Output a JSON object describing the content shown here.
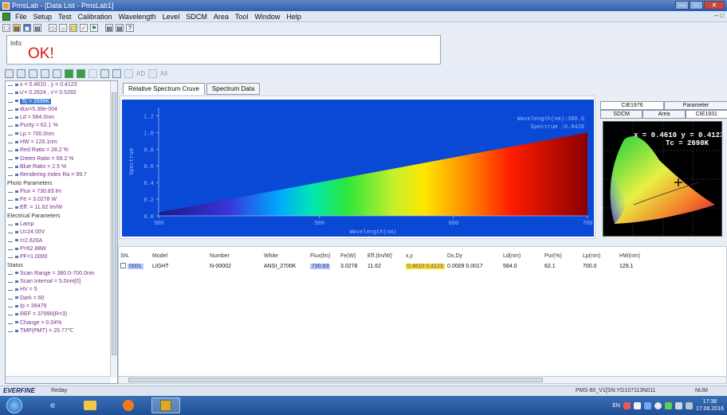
{
  "window": {
    "title": "PmsLab - [Data List - PmsLab1]"
  },
  "menu": [
    "File",
    "Setup",
    "Test",
    "Calibration",
    "Wavelength",
    "Level",
    "SDCM",
    "Area",
    "Tool",
    "Window",
    "Help"
  ],
  "info": {
    "label": "Info:",
    "status": "OK!"
  },
  "toolbar2": {
    "text1": "AD",
    "text2": "All"
  },
  "tree": {
    "items": [
      {
        "kind": "node",
        "text": "x = 0.4610 , y = 0.4123"
      },
      {
        "kind": "node",
        "text": "u'= 0.2624 , v'= 0.5282"
      },
      {
        "kind": "node",
        "text": "Tc = 2698K",
        "selected": true
      },
      {
        "kind": "node",
        "text": "duv=5.36e-004"
      },
      {
        "kind": "node",
        "text": "Ld = 584.0nm"
      },
      {
        "kind": "node",
        "text": "Purity = 62.1 %"
      },
      {
        "kind": "node",
        "text": "Lp = 700.0nm"
      },
      {
        "kind": "node",
        "text": "HW = 129.1nm"
      },
      {
        "kind": "node",
        "text": "Red Ratio = 28.2 %"
      },
      {
        "kind": "node",
        "text": "Green Ratio = 69.2 %"
      },
      {
        "kind": "node",
        "text": "Blue Ratio = 2.5 %"
      },
      {
        "kind": "node",
        "text": "Rendering Index Ra = 99.7"
      },
      {
        "kind": "group",
        "text": "Photo Parameters"
      },
      {
        "kind": "node",
        "text": "Flux = 730.83 lm"
      },
      {
        "kind": "node",
        "text": "Fe = 3.0278 W"
      },
      {
        "kind": "node",
        "text": "Eff. = 11.62 lm/W"
      },
      {
        "kind": "group",
        "text": "Electrical Parameters"
      },
      {
        "kind": "node",
        "text": "Lamp"
      },
      {
        "kind": "node",
        "text": "U=24.00V"
      },
      {
        "kind": "node",
        "text": "I=2.620A"
      },
      {
        "kind": "node",
        "text": "P=62.88W"
      },
      {
        "kind": "node",
        "text": "PF=1.0000"
      },
      {
        "kind": "group",
        "text": "Status"
      },
      {
        "kind": "node",
        "text": "Scan Range = 380.0-700.0nm"
      },
      {
        "kind": "node",
        "text": "Scan Interval = 5.0nm[0]"
      },
      {
        "kind": "node",
        "text": "HV = 5"
      },
      {
        "kind": "node",
        "text": "Dark = 60"
      },
      {
        "kind": "node",
        "text": "Ip = 39479"
      },
      {
        "kind": "node",
        "text": "REF = 37990(R=3)"
      },
      {
        "kind": "node",
        "text": "Change = 0.04%"
      },
      {
        "kind": "node",
        "text": "TMP(PMT) = 25.77℃"
      }
    ]
  },
  "tabs": [
    "Relative Spectrum Cruve",
    "Spectrum Data"
  ],
  "cie_tabs": {
    "row1": [
      "CIE1976",
      "Parameter"
    ],
    "row2": [
      "SDCM",
      "Area",
      "CIE1931"
    ]
  },
  "cie_readout": {
    "line1": "x = 0.4610 y = 0.4123",
    "line2": "Tc = 2698K"
  },
  "chart_data": {
    "type": "area",
    "xlabel": "Wavelength(nm)",
    "ylabel": "Spectrum",
    "xlim": [
      380,
      700
    ],
    "ylim": [
      0,
      1.3
    ],
    "xticks": [
      380,
      500,
      600,
      700
    ],
    "yticks": [
      0.0,
      0.2,
      0.4,
      0.6,
      0.8,
      1.0,
      1.2
    ],
    "x": [
      380,
      700
    ],
    "y": [
      0.0428,
      1.0
    ],
    "annotation": {
      "line1": "Wavelength(nm):380.0",
      "line2": "Spectrum :0.0428"
    },
    "colors": {
      "background": "#0a49d6",
      "axis": "#9fb8ff"
    }
  },
  "table": {
    "headers": [
      "SN.",
      "Model",
      "Number",
      "White",
      "Flux(lm)",
      "Fe(W)",
      "Eff.(lm/W)",
      "x,y",
      "Dx,Dy",
      "Ld(nm)",
      "Pur(%)",
      "Lp(nm)",
      "HW(nm)"
    ],
    "rows": [
      [
        "0001",
        "LIGHT",
        "N-00002",
        "ANSI_2700K",
        "730.83",
        "3.0278",
        "11.62",
        "0.4610 0.4123",
        "0.0009 0.0017",
        "584.0",
        "62.1",
        "700.0",
        "129.1"
      ]
    ]
  },
  "statusbar": {
    "brand": "EVERFINE",
    "ready": "Reday",
    "model": "PMS-80_V1[SN:YG107113N011",
    "num": "NUM"
  },
  "taskbar": {
    "lang": "EN",
    "time": "17:38",
    "date": "17.06.2016"
  }
}
